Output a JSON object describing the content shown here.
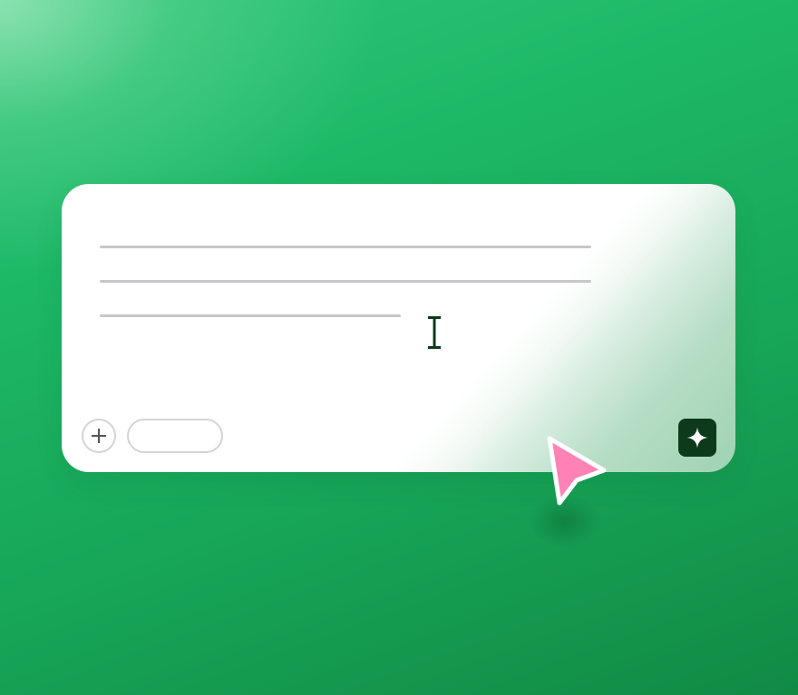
{
  "composer": {
    "text_lines": 3,
    "add_icon": "plus-icon",
    "sparkle_icon": "sparkle-icon",
    "cursor_icon": "text-cursor-icon"
  },
  "pointer": {
    "icon": "pointer-arrow-icon",
    "color": "#ff82b5",
    "outline": "#ffffff"
  },
  "colors": {
    "background_top": "#7ad9a4",
    "background_main": "#1db866",
    "background_bottom": "#118a44",
    "card": "#ffffff",
    "placeholder_line": "#c7c7ca",
    "submit_button": "#0d3a1a"
  }
}
